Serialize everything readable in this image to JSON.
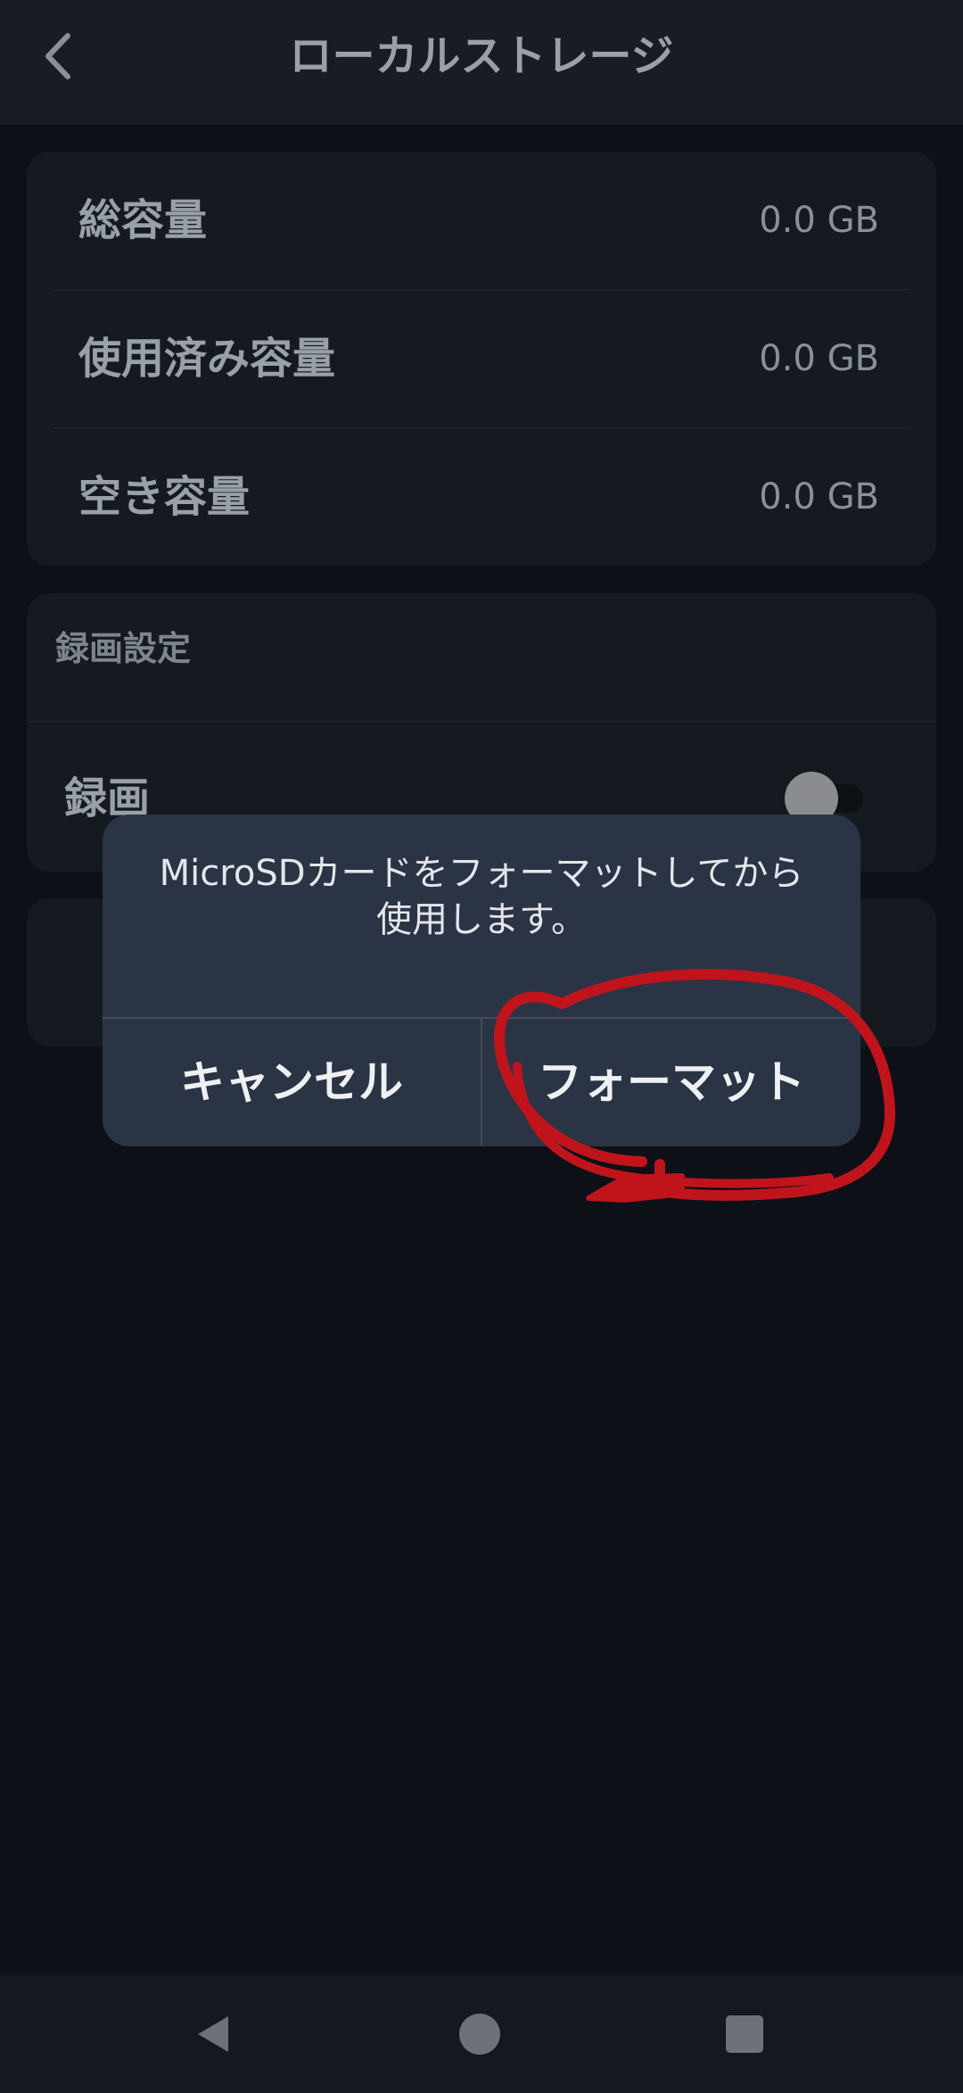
{
  "header": {
    "title": "ローカルストレージ",
    "back_icon": "chevron-left-icon"
  },
  "storage": {
    "rows": [
      {
        "label": "総容量",
        "value": "0.0 GB"
      },
      {
        "label": "使用済み容量",
        "value": "0.0 GB"
      },
      {
        "label": "空き容量",
        "value": "0.0 GB"
      }
    ]
  },
  "recording": {
    "section_title": "録画設定",
    "label": "録画",
    "toggle_on": false
  },
  "dialog": {
    "message": "MicroSDカードをフォーマットしてから使用します。",
    "cancel_label": "キャンセル",
    "format_label": "フォーマット"
  },
  "navbar": {
    "back_icon": "triangle-back-icon",
    "home_icon": "circle-home-icon",
    "recents_icon": "square-recents-icon"
  },
  "colors": {
    "background": "#0d1117",
    "card": "#151a21",
    "dialog": "#2b3444",
    "annotation": "#c0141c"
  }
}
